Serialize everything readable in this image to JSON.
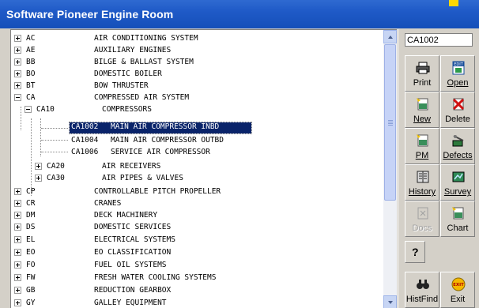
{
  "window": {
    "title": "Software Pioneer Engine Room"
  },
  "search": {
    "value": "CA1002"
  },
  "tree": {
    "rows": [
      {
        "code": "AC",
        "desc": "AIR CONDITIONING SYSTEM"
      },
      {
        "code": "AE",
        "desc": "AUXILIARY ENGINES"
      },
      {
        "code": "BB",
        "desc": "BILGE & BALLAST SYSTEM"
      },
      {
        "code": "BO",
        "desc": "DOMESTIC BOILER"
      },
      {
        "code": "BT",
        "desc": "BOW THRUSTER"
      },
      {
        "code": "CA",
        "desc": "COMPRESSED AIR SYSTEM"
      },
      {
        "code": "CA10",
        "desc": "COMPRESSORS"
      },
      {
        "code": "CA1002",
        "desc": "MAIN AIR COMPRESSOR INBD"
      },
      {
        "code": "CA1004",
        "desc": "MAIN AIR COMPRESSOR OUTBD"
      },
      {
        "code": "CA1006",
        "desc": "SERVICE AIR COMPRESSOR"
      },
      {
        "code": "CA20",
        "desc": "AIR RECEIVERS"
      },
      {
        "code": "CA30",
        "desc": "AIR PIPES & VALVES"
      },
      {
        "code": "CP",
        "desc": "CONTROLLABLE PITCH PROPELLER"
      },
      {
        "code": "CR",
        "desc": "CRANES"
      },
      {
        "code": "DM",
        "desc": "DECK MACHINERY"
      },
      {
        "code": "DS",
        "desc": "DOMESTIC SERVICES"
      },
      {
        "code": "EL",
        "desc": "ELECTRICAL SYSTEMS"
      },
      {
        "code": "EO",
        "desc": "EO CLASSIFICATION"
      },
      {
        "code": "FO",
        "desc": "FUEL OIL SYSTEMS"
      },
      {
        "code": "FW",
        "desc": "FRESH WATER COOLING SYSTEMS"
      },
      {
        "code": "GB",
        "desc": "REDUCTION GEARBOX"
      },
      {
        "code": "GY",
        "desc": "GALLEY EQUIPMENT"
      }
    ]
  },
  "toolbar": {
    "print": "Print",
    "open": "Open",
    "new": "New",
    "delete": "Delete",
    "pm": "PM",
    "defects": "Defects",
    "history": "History",
    "survey": "Survey",
    "docs": "Docs",
    "chart": "Chart",
    "histfind": "HistFind",
    "exit": "Exit"
  },
  "icons": {
    "edit_badge": "EDIT",
    "exit_badge": "EXIT",
    "help_glyph": "?"
  }
}
